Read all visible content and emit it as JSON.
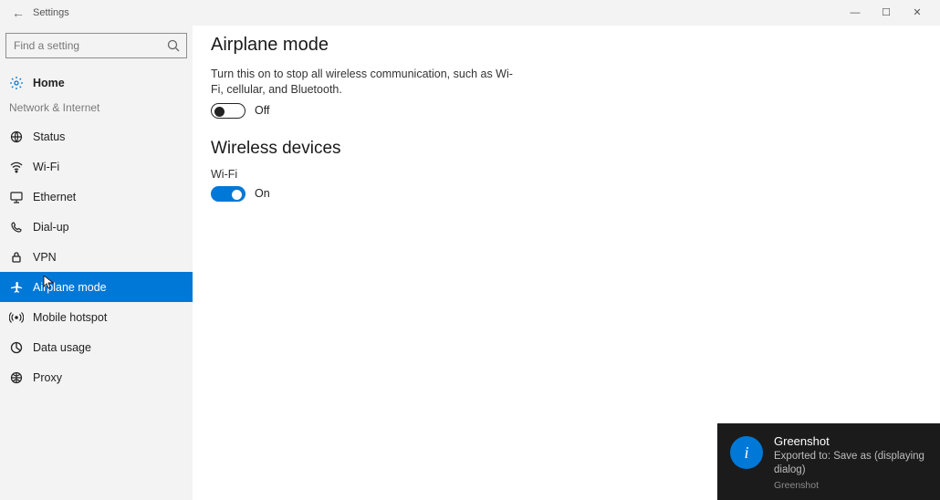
{
  "titlebar": {
    "title": "Settings"
  },
  "search": {
    "placeholder": "Find a setting"
  },
  "home_label": "Home",
  "section_label": "Network & Internet",
  "sidebar": {
    "items": [
      {
        "label": "Status"
      },
      {
        "label": "Wi-Fi"
      },
      {
        "label": "Ethernet"
      },
      {
        "label": "Dial-up"
      },
      {
        "label": "VPN"
      },
      {
        "label": "Airplane mode"
      },
      {
        "label": "Mobile hotspot"
      },
      {
        "label": "Data usage"
      },
      {
        "label": "Proxy"
      }
    ]
  },
  "main": {
    "heading": "Airplane mode",
    "description": "Turn this on to stop all wireless communication, such as Wi-Fi, cellular, and Bluetooth.",
    "airplane_state": "Off",
    "wireless_heading": "Wireless devices",
    "wifi_label": "Wi-Fi",
    "wifi_state": "On"
  },
  "toast": {
    "title": "Greenshot",
    "body": "Exported to: Save as (displaying dialog)",
    "app": "Greenshot"
  }
}
